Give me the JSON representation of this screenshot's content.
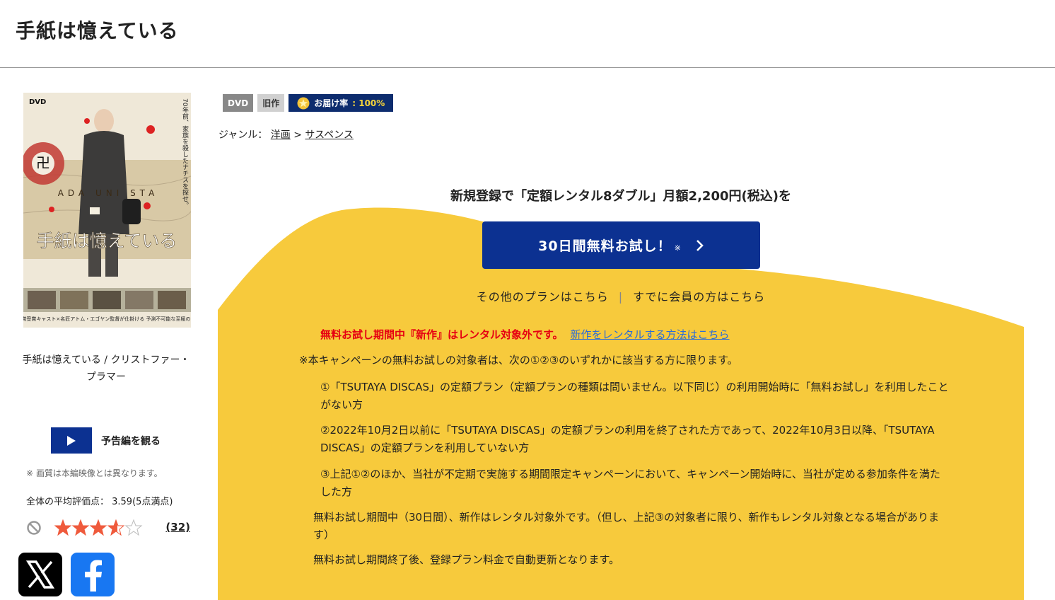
{
  "page": {
    "title": "手紙は憶えている"
  },
  "product": {
    "caption": "手紙は憶えている / クリストファー・プラマー",
    "jacket": {
      "dvd_mark": "DVD",
      "title_text": "手紙は憶えている",
      "tagline": "70年前、家族を殺したナチスを探せ。",
      "map_text": "ADA UNI STA",
      "bottom_text": "アカデミー賞受賞キャスト×名匠アトム・エゴヤン監督が仕掛ける 予測不可能な至極のサスペンス!"
    },
    "trailer_label": "予告編を観る",
    "quality_note": "※ 画質は本編映像とは異なります。",
    "avg_rating_text": "全体の平均評価点： 3.59(5点満点)",
    "rating_value": 3.59,
    "rating_max": 5,
    "review_count": "(32)",
    "share_x_icon": "x-logo-icon",
    "share_fb_icon": "facebook-logo-icon"
  },
  "badges": {
    "format": "DVD",
    "age": "旧作",
    "delivery_label": "お届け率",
    "delivery_rate": ": 100%"
  },
  "genre": {
    "label": "ジャンル：",
    "category": "洋画",
    "separator": ">",
    "subcategory": "サスペンス"
  },
  "promo": {
    "heading": "新規登録で「定額レンタル8ダブル」月額2,200円(税込)を",
    "trial_button": "30日間無料お試し！",
    "trial_mark": "※",
    "other_plans": "その他のプランはこちら",
    "separator": "|",
    "members": "すでに会員の方はこちら",
    "warning_red": "無料お試し期間中『新作』はレンタル対象外です。",
    "warning_link": "新作をレンタルする方法はこちら",
    "terms": [
      "※本キャンペーンの無料お試しの対象者は、次の①②③のいずれかに該当する方に限ります。",
      "①「TSUTAYA DISCAS」の定額プラン（定額プランの種類は問いません。以下同じ）の利用開始時に「無料お試し」を利用したことがない方",
      "②2022年10月2日以前に「TSUTAYA DISCAS」の定額プランの利用を終了された方であって、2022年10月3日以降、「TSUTAYA DISCAS」の定額プランを利用していない方",
      "③上記①②のほか、当社が不定期で実施する期間限定キャンペーンにおいて、キャンペーン開始時に、当社が定める参加条件を満たした方",
      "無料お試し期間中（30日間）、新作はレンタル対象外です。（但し、上記③の対象者に限り、新作もレンタル対象となる場合があります）",
      "無料お試し期間終了後、登録プラン料金で自動更新となります。"
    ]
  },
  "colors": {
    "navy": "#0c3191",
    "yellow": "#f7ca3c",
    "red": "#e60012",
    "link": "#2a6bd8"
  }
}
